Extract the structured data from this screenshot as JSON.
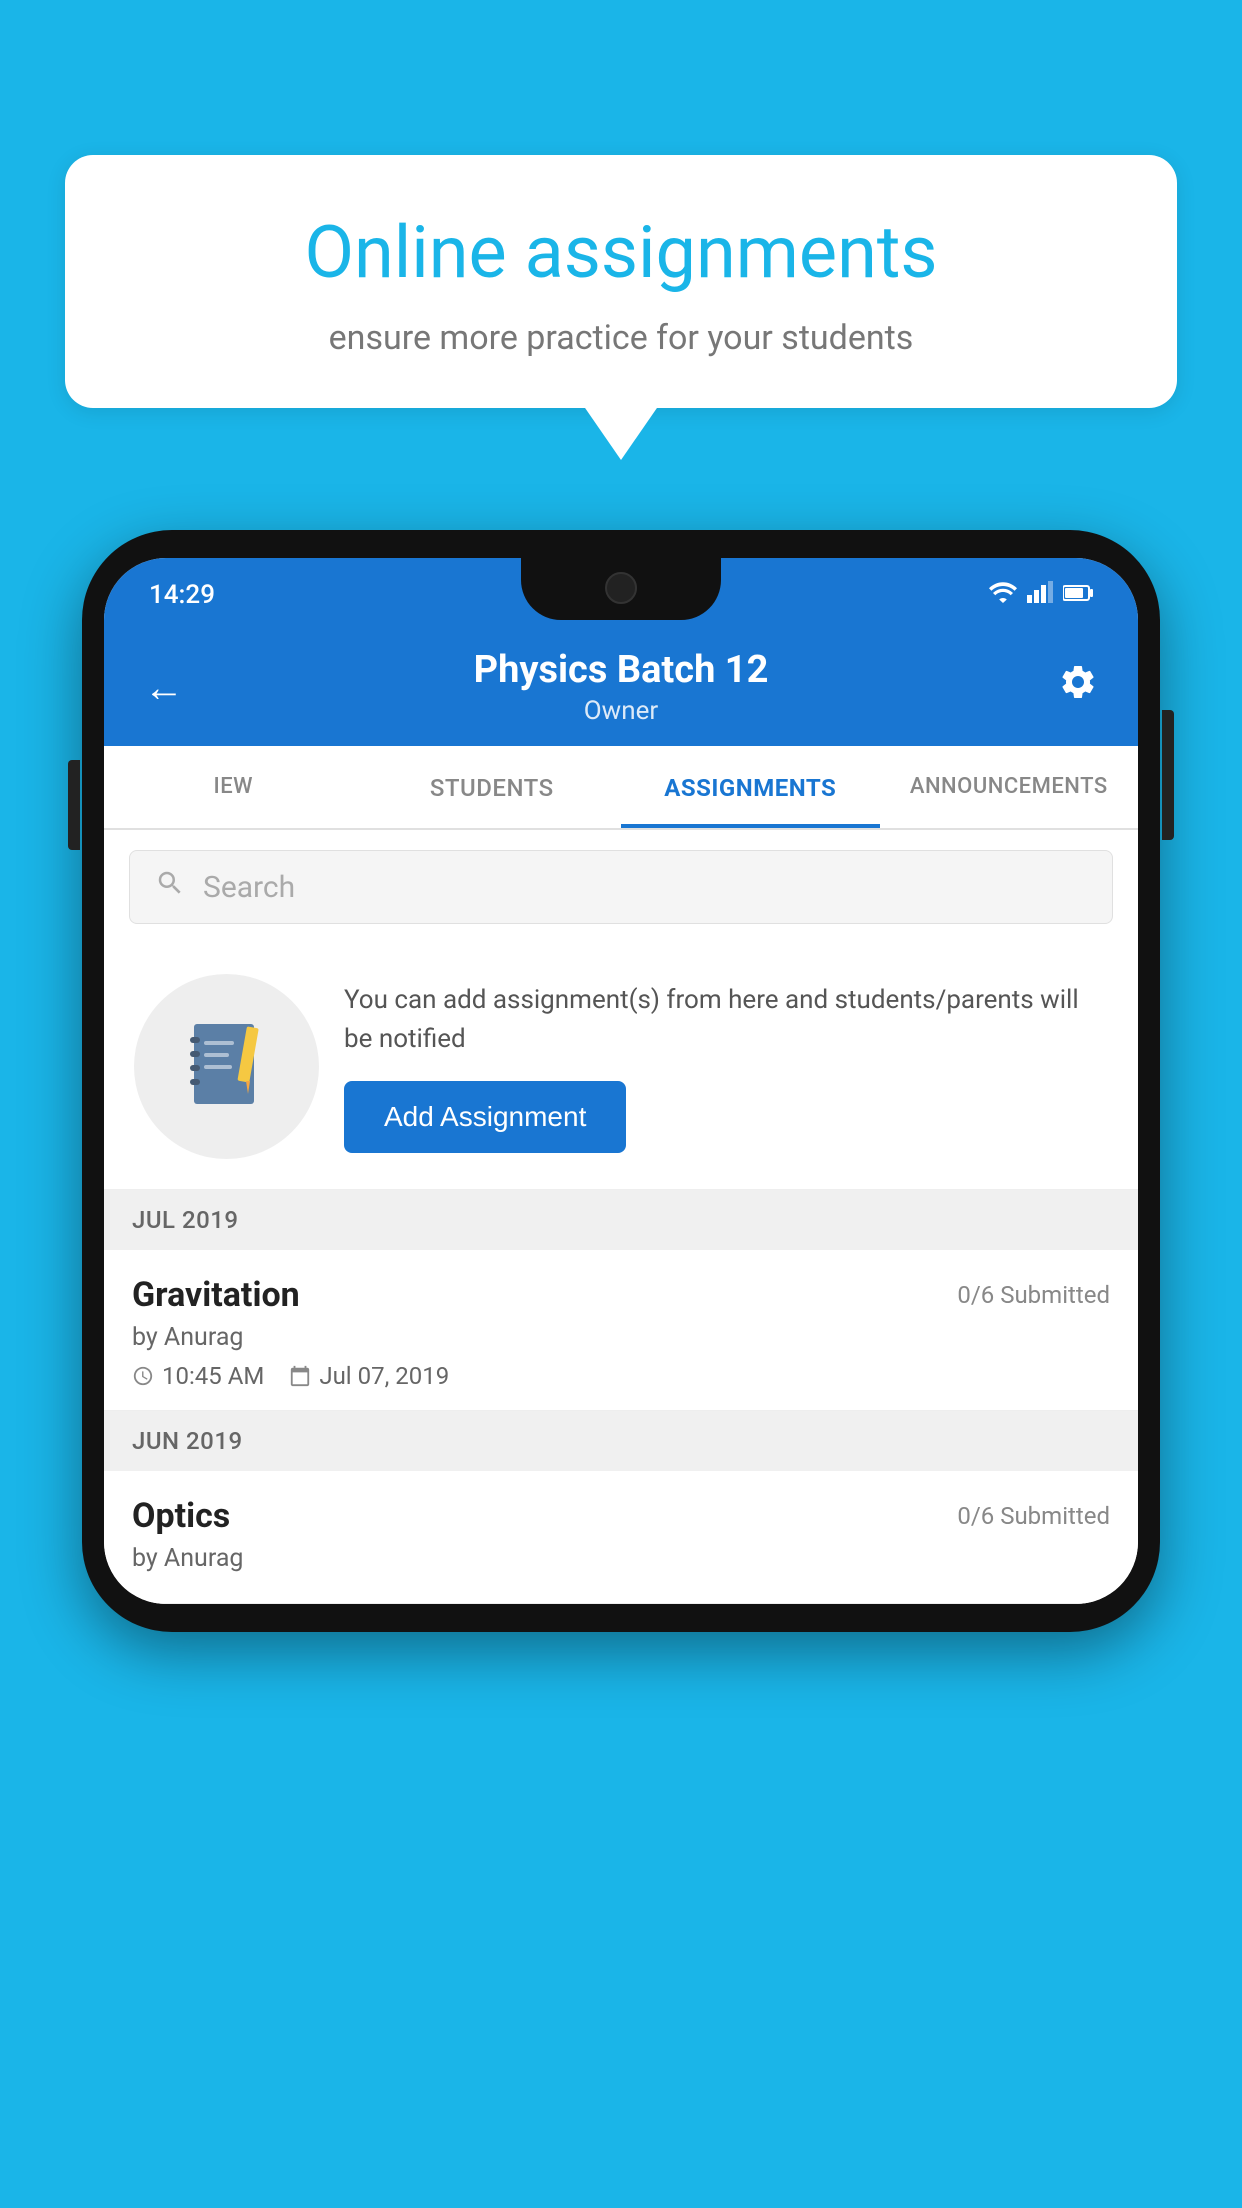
{
  "background_color": "#1ab5e8",
  "speech_bubble": {
    "title": "Online assignments",
    "subtitle": "ensure more practice for your students"
  },
  "status_bar": {
    "time": "14:29",
    "wifi_icon": "wifi",
    "signal_icon": "signal",
    "battery_icon": "battery"
  },
  "header": {
    "title": "Physics Batch 12",
    "subtitle": "Owner",
    "back_label": "←",
    "settings_label": "⚙"
  },
  "tabs": [
    {
      "label": "IEW",
      "active": false
    },
    {
      "label": "STUDENTS",
      "active": false
    },
    {
      "label": "ASSIGNMENTS",
      "active": true
    },
    {
      "label": "ANNOUNCEMENTS",
      "active": false
    }
  ],
  "search": {
    "placeholder": "Search"
  },
  "assignment_banner": {
    "description": "You can add assignment(s) from here and students/parents will be notified",
    "button_label": "Add Assignment"
  },
  "sections": [
    {
      "month": "JUL 2019",
      "assignments": [
        {
          "name": "Gravitation",
          "submitted": "0/6 Submitted",
          "by": "by Anurag",
          "time": "10:45 AM",
          "date": "Jul 07, 2019"
        }
      ]
    },
    {
      "month": "JUN 2019",
      "assignments": [
        {
          "name": "Optics",
          "submitted": "0/6 Submitted",
          "by": "by Anurag",
          "time": "",
          "date": ""
        }
      ]
    }
  ]
}
